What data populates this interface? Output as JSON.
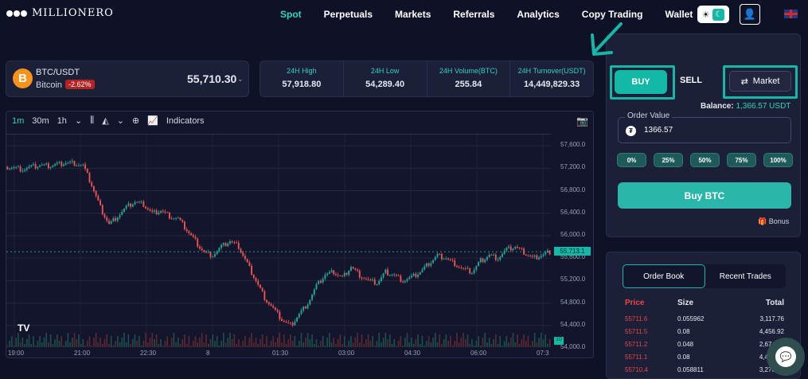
{
  "brand": {
    "name": "MILLIONERO"
  },
  "nav": {
    "items": [
      "Spot",
      "Perpetuals",
      "Markets",
      "Referrals",
      "Analytics",
      "Copy Trading",
      "Wallet"
    ],
    "active": "Spot"
  },
  "ticker": {
    "pair": "BTC/USDT",
    "coin": "Bitcoin",
    "change": "-2.62%",
    "price": "55,710.30",
    "coin_icon": "B"
  },
  "stats": [
    {
      "label": "24H High",
      "value": "57,918.80"
    },
    {
      "label": "24H Low",
      "value": "54,289.40"
    },
    {
      "label": "24H Volume(BTC)",
      "value": "255.84"
    },
    {
      "label": "24H Turnover(USDT)",
      "value": "14,449,829.33"
    }
  ],
  "chart_toolbar": {
    "intervals": [
      "1m",
      "30m",
      "1h"
    ],
    "selected": "1m",
    "indicators": "Indicators"
  },
  "chart_data": {
    "type": "candlestick",
    "last_price": "55,713.1",
    "volume_label": "10",
    "y_ticks": [
      "57,600.0",
      "57,200.0",
      "56,800.0",
      "56,400.0",
      "56,000.0",
      "55,600.0",
      "55,200.0",
      "54,800.0",
      "54,400.0",
      "54,000.0"
    ],
    "x_ticks": [
      "19:00",
      "21:00",
      "22:30",
      "8",
      "01:30",
      "03:00",
      "04:30",
      "06:00",
      "07:3"
    ],
    "ylim": [
      54000,
      57800
    ],
    "close_series": [
      57230,
      57210,
      57180,
      57220,
      57250,
      57240,
      57270,
      57300,
      57290,
      57250,
      56900,
      56500,
      56200,
      56350,
      56500,
      56600,
      56550,
      56400,
      56450,
      56350,
      56300,
      56100,
      55900,
      55700,
      55650,
      55800,
      55900,
      55800,
      55500,
      55200,
      54900,
      54700,
      54500,
      54400,
      54600,
      54800,
      55100,
      55300,
      55350,
      55250,
      55450,
      55300,
      55200,
      55150,
      55350,
      55300,
      55200,
      55250,
      55350,
      55500,
      55650,
      55600,
      55500,
      55400,
      55350,
      55550,
      55650,
      55600,
      55750,
      55800,
      55700,
      55600,
      55650,
      55713
    ]
  },
  "order": {
    "buy": "BUY",
    "sell": "SELL",
    "market": "Market",
    "balance_label": "Balance:",
    "balance_value": "1,366.57 USDT",
    "order_value_label": "Order Value",
    "order_value": "1366.57",
    "percents": [
      "0%",
      "25%",
      "50%",
      "75%",
      "100%"
    ],
    "submit": "Buy BTC",
    "bonus": "Bonus"
  },
  "book": {
    "tabs": [
      "Order Book",
      "Recent Trades"
    ],
    "headers": [
      "Price",
      "Size",
      "Total"
    ],
    "rows": [
      [
        "55711.6",
        "0.055962",
        "3,117.76"
      ],
      [
        "55711.5",
        "0.08",
        "4,456.92"
      ],
      [
        "55711.2",
        "0.048",
        "2,674.14"
      ],
      [
        "55711.1",
        "0.08",
        "4,456.89"
      ],
      [
        "55710.4",
        "0.058811",
        "3,276.43"
      ]
    ]
  }
}
